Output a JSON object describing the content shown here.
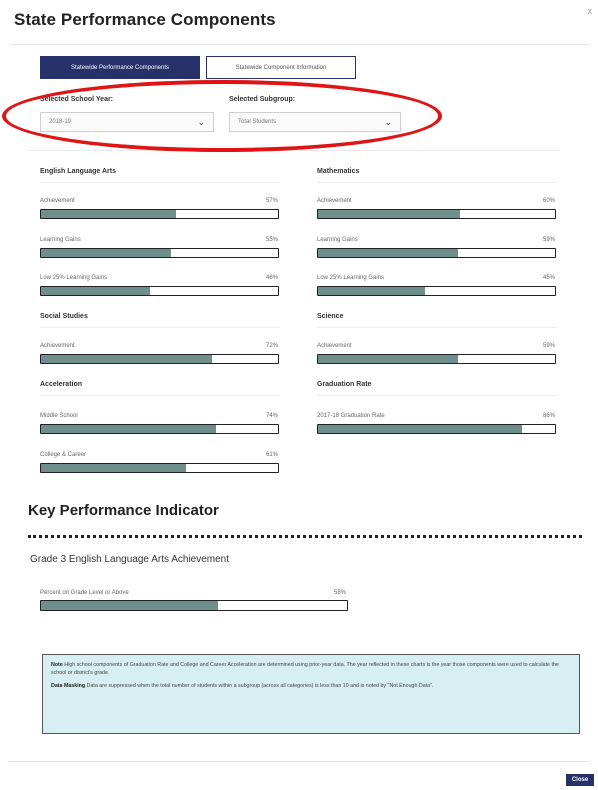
{
  "modal": {
    "title": "State Performance Components",
    "close_x": "x",
    "close_button": "Close"
  },
  "tabs": [
    {
      "label": "Statewide Performance Components",
      "active": true
    },
    {
      "label": "Statewide Component Information",
      "active": false
    }
  ],
  "selectors": {
    "school_year": {
      "label": "Selected School Year:",
      "value": "2018-19"
    },
    "subgroup": {
      "label": "Selected Subgroup:",
      "value": "Total Students"
    }
  },
  "sections": {
    "ela": {
      "title": "English Language Arts",
      "metrics": [
        {
          "label": "Achievement",
          "value": "57%",
          "fraction": 0.57
        },
        {
          "label": "Learning Gains",
          "value": "55%",
          "fraction": 0.55
        },
        {
          "label": "Low 25% Learning Gains",
          "value": "46%",
          "fraction": 0.46
        }
      ]
    },
    "math": {
      "title": "Mathematics",
      "metrics": [
        {
          "label": "Achievement",
          "value": "60%",
          "fraction": 0.6
        },
        {
          "label": "Learning Gains",
          "value": "59%",
          "fraction": 0.59
        },
        {
          "label": "Low 25% Learning Gains",
          "value": "45%",
          "fraction": 0.45
        }
      ]
    },
    "social": {
      "title": "Social Studies",
      "metrics": [
        {
          "label": "Achievement",
          "value": "72%",
          "fraction": 0.72
        }
      ]
    },
    "science": {
      "title": "Science",
      "metrics": [
        {
          "label": "Achievement",
          "value": "59%",
          "fraction": 0.59
        }
      ]
    },
    "acceleration": {
      "title": "Acceleration",
      "metrics": [
        {
          "label": "Middle School",
          "value": "74%",
          "fraction": 0.74
        },
        {
          "label": "College & Career",
          "value": "61%",
          "fraction": 0.61
        }
      ]
    },
    "graduation": {
      "title": "Graduation Rate",
      "metrics": [
        {
          "label": "2017-18 Graduation Rate",
          "value": "86%",
          "fraction": 0.86
        }
      ]
    }
  },
  "kpi": {
    "title": "Key Performance Indicator",
    "subtitle": "Grade 3 English Language Arts Achievement",
    "metric": {
      "label": "Percent on Grade Level or Above",
      "value": "58%",
      "fraction": 0.58
    }
  },
  "note": {
    "note_label": "Note",
    "note_text": "High school components of Graduation Rate and College and Career Acceleration are determined using prior-year data. The year reflected in these charts is the year those components were used to calculate the school or district's grade.",
    "masking_label": "Data Masking",
    "masking_text": "Data are suppressed when the total number of students within a subgroup (across all categories) is less than 10 and is noted by \"Not Enough Data\"."
  },
  "colors": {
    "navy": "#263069",
    "bar_fill": "#6e8f8c",
    "note_bg": "#d7eef3",
    "highlight_red": "#e01414"
  }
}
